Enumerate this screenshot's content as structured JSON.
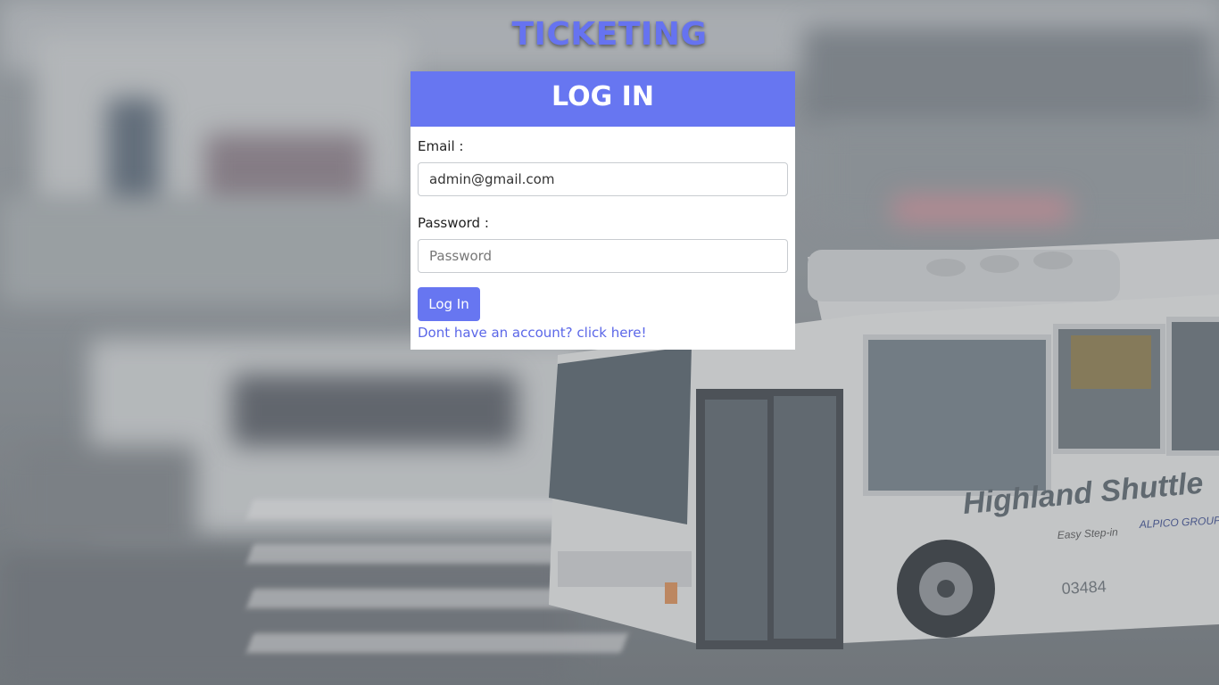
{
  "app": {
    "title": "TICKETING"
  },
  "login": {
    "header": "LOG IN",
    "email_label": "Email :",
    "email_value": "admin@gmail.com",
    "password_label": "Password :",
    "password_placeholder": "Password",
    "submit_label": "Log In",
    "signup_link": "Dont have an account? click here!"
  },
  "background": {
    "bus_text": "Highland Shuttle",
    "bus_number": "03484",
    "bus_small_text": "Easy Step-in",
    "bus_brand": "ALPICO GROUP"
  },
  "colors": {
    "accent": "#6776f1",
    "title": "#6673f0",
    "link": "#5b67e8"
  }
}
